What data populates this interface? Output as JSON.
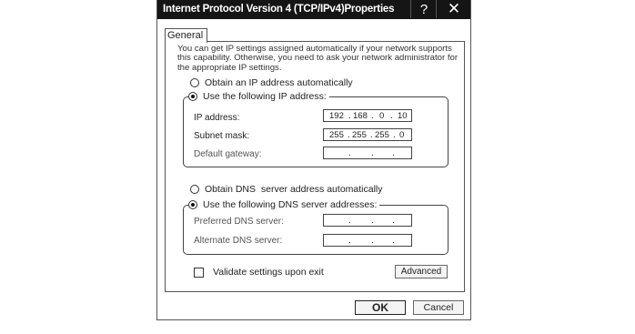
{
  "window": {
    "title": "Internet Protocol Version 4 (TCP/IPv4)Properties",
    "help_glyph": "?",
    "close_glyph": "✕"
  },
  "tabs": [
    {
      "label": "General",
      "selected": true
    }
  ],
  "description": "You can get IP settings assigned automatically if your network supports this capability. Otherwise, you need to ask your network administrator for the appropriate IP settings.",
  "ip_section": {
    "auto_label": "Obtain an IP address automatically",
    "auto_selected": false,
    "manual_label": "Use the following IP address:",
    "manual_selected": true,
    "fields": [
      {
        "label": "IP address:",
        "octets": [
          "192",
          "168",
          "0",
          "10"
        ],
        "enabled": true
      },
      {
        "label": "Subnet mask:",
        "octets": [
          "255",
          "255",
          "255",
          "0"
        ],
        "enabled": true
      },
      {
        "label": "Default gateway:",
        "octets": [
          "",
          "",
          "",
          ""
        ],
        "enabled": true
      }
    ]
  },
  "dns_section": {
    "auto_label": "Obtain DNS  server address automatically",
    "auto_selected": false,
    "manual_label": "Use the following DNS server addresses:",
    "manual_selected": true,
    "fields": [
      {
        "label": "Preferred DNS server:",
        "octets": [
          "",
          "",
          "",
          ""
        ]
      },
      {
        "label": "Alternate DNS server:",
        "octets": [
          "",
          "",
          "",
          ""
        ]
      }
    ]
  },
  "validate": {
    "label": "Validate settings upon exit",
    "checked": false
  },
  "buttons": {
    "advanced": "Advanced",
    "ok": "OK",
    "cancel": "Cancel"
  }
}
